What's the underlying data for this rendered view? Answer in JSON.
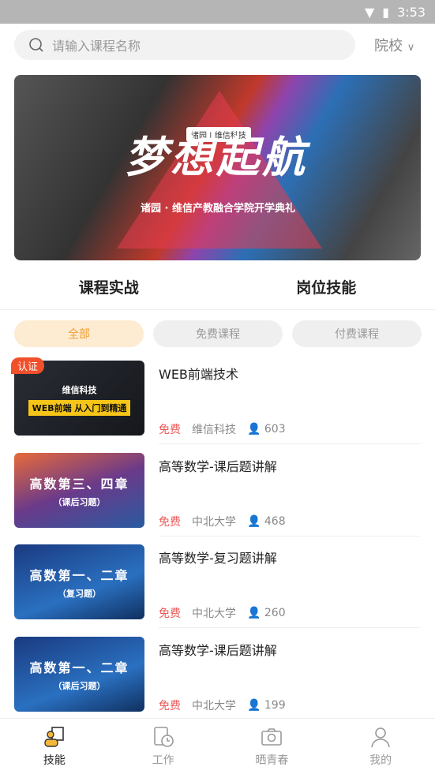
{
  "status": {
    "time": "3:53"
  },
  "search": {
    "placeholder": "请输入课程名称",
    "school_label": "院校"
  },
  "banner": {
    "headline": "梦想起航",
    "logos": "诸园 | 维信科技",
    "caption": "诸园 · 维信产教融合学院开学典礼"
  },
  "tabs": [
    "课程实战",
    "岗位技能"
  ],
  "filters": [
    "全部",
    "免费课程",
    "付费课程"
  ],
  "courses": [
    {
      "badge": "认证",
      "title": "WEB前端技术",
      "price": "免费",
      "org": "维信科技",
      "count": "603",
      "thumb_text": "WEB前端 从入门到精通",
      "thumb_sub": "维信科技"
    },
    {
      "title": "高等数学-课后题讲解",
      "price": "免费",
      "org": "中北大学",
      "count": "468",
      "thumb_text": "高数第三、四章",
      "thumb_sub": "（课后习题）"
    },
    {
      "title": "高等数学-复习题讲解",
      "price": "免费",
      "org": "中北大学",
      "count": "260",
      "thumb_text": "高数第一、二章",
      "thumb_sub": "（复习题）"
    },
    {
      "title": "高等数学-课后题讲解",
      "price": "免费",
      "org": "中北大学",
      "count": "199",
      "thumb_text": "高数第一、二章",
      "thumb_sub": "（课后习题）"
    }
  ],
  "nav": [
    "技能",
    "工作",
    "晒青春",
    "我的"
  ],
  "colors": {
    "accent": "#f0a030",
    "free": "#ee5a5a",
    "badge": "#f0502a"
  }
}
